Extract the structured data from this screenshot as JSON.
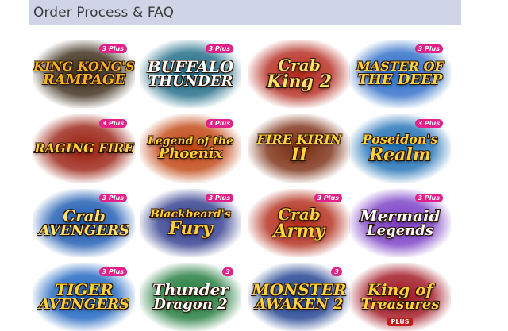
{
  "header": {
    "title": "Order Process & FAQ"
  },
  "games": [
    {
      "line1": "KING KONG'S",
      "line2": "RAMPAGE",
      "color": "#f6b21b",
      "bg": "#3a2a18",
      "badge": "3 Plus"
    },
    {
      "line1": "BUFFALO",
      "line2": "THUNDER",
      "color": "#ffffff",
      "bg": "#1c6a86",
      "badge": "3 Plus"
    },
    {
      "line1": "Crab",
      "line2": "King 2",
      "color": "#ffe36b",
      "bg": "#b4281c",
      "badge": ""
    },
    {
      "line1": "MASTER OF",
      "line2": "THE DEEP",
      "color": "#ffd23c",
      "bg": "#2c6cc8",
      "badge": "3 Plus"
    },
    {
      "line1": "RAGING FIRE",
      "line2": "",
      "color": "#ffd23c",
      "bg": "#9a1e10",
      "badge": "3 Plus"
    },
    {
      "line1": "Legend of the",
      "line2": "Phoenix",
      "color": "#ffcf35",
      "bg": "#c1430f",
      "badge": "3 Plus"
    },
    {
      "line1": "FIRE KIRIN",
      "line2": "II",
      "color": "#ffd23c",
      "bg": "#7a2b10",
      "badge": ""
    },
    {
      "line1": "Poseidon's",
      "line2": "Realm",
      "color": "#ffd23c",
      "bg": "#1d6fb5",
      "badge": "3 Plus"
    },
    {
      "line1": "Crab",
      "line2": "AVENGERS",
      "color": "#ffe36b",
      "bg": "#1a58b0",
      "badge": "3 Plus"
    },
    {
      "line1": "Blackbeard's",
      "line2": "Fury",
      "color": "#ffcf35",
      "bg": "#2f3b8c",
      "badge": "3 Plus"
    },
    {
      "line1": "Crab",
      "line2": "Army",
      "color": "#ffd23c",
      "bg": "#b22a18",
      "badge": "3 Plus"
    },
    {
      "line1": "Mermaid",
      "line2": "Legends",
      "color": "#ffffff",
      "bg": "#7a3cc6",
      "badge": "3 Plus"
    },
    {
      "line1": "TIGER",
      "line2": "AVENGERS",
      "color": "#ffd23c",
      "bg": "#1b63c0",
      "badge": "3 Plus"
    },
    {
      "line1": "Thunder",
      "line2": "Dragon 2",
      "color": "#ffffff",
      "bg": "#1f7a3a",
      "badge": "3"
    },
    {
      "line1": "MONSTER",
      "line2": "AWAKEN 2",
      "color": "#ffd23c",
      "bg": "#1d3f8f",
      "badge": "3"
    },
    {
      "line1": "King of",
      "line2": "Treasures",
      "color": "#ffd23c",
      "bg": "#a0121e",
      "badge": "PLUS"
    }
  ]
}
